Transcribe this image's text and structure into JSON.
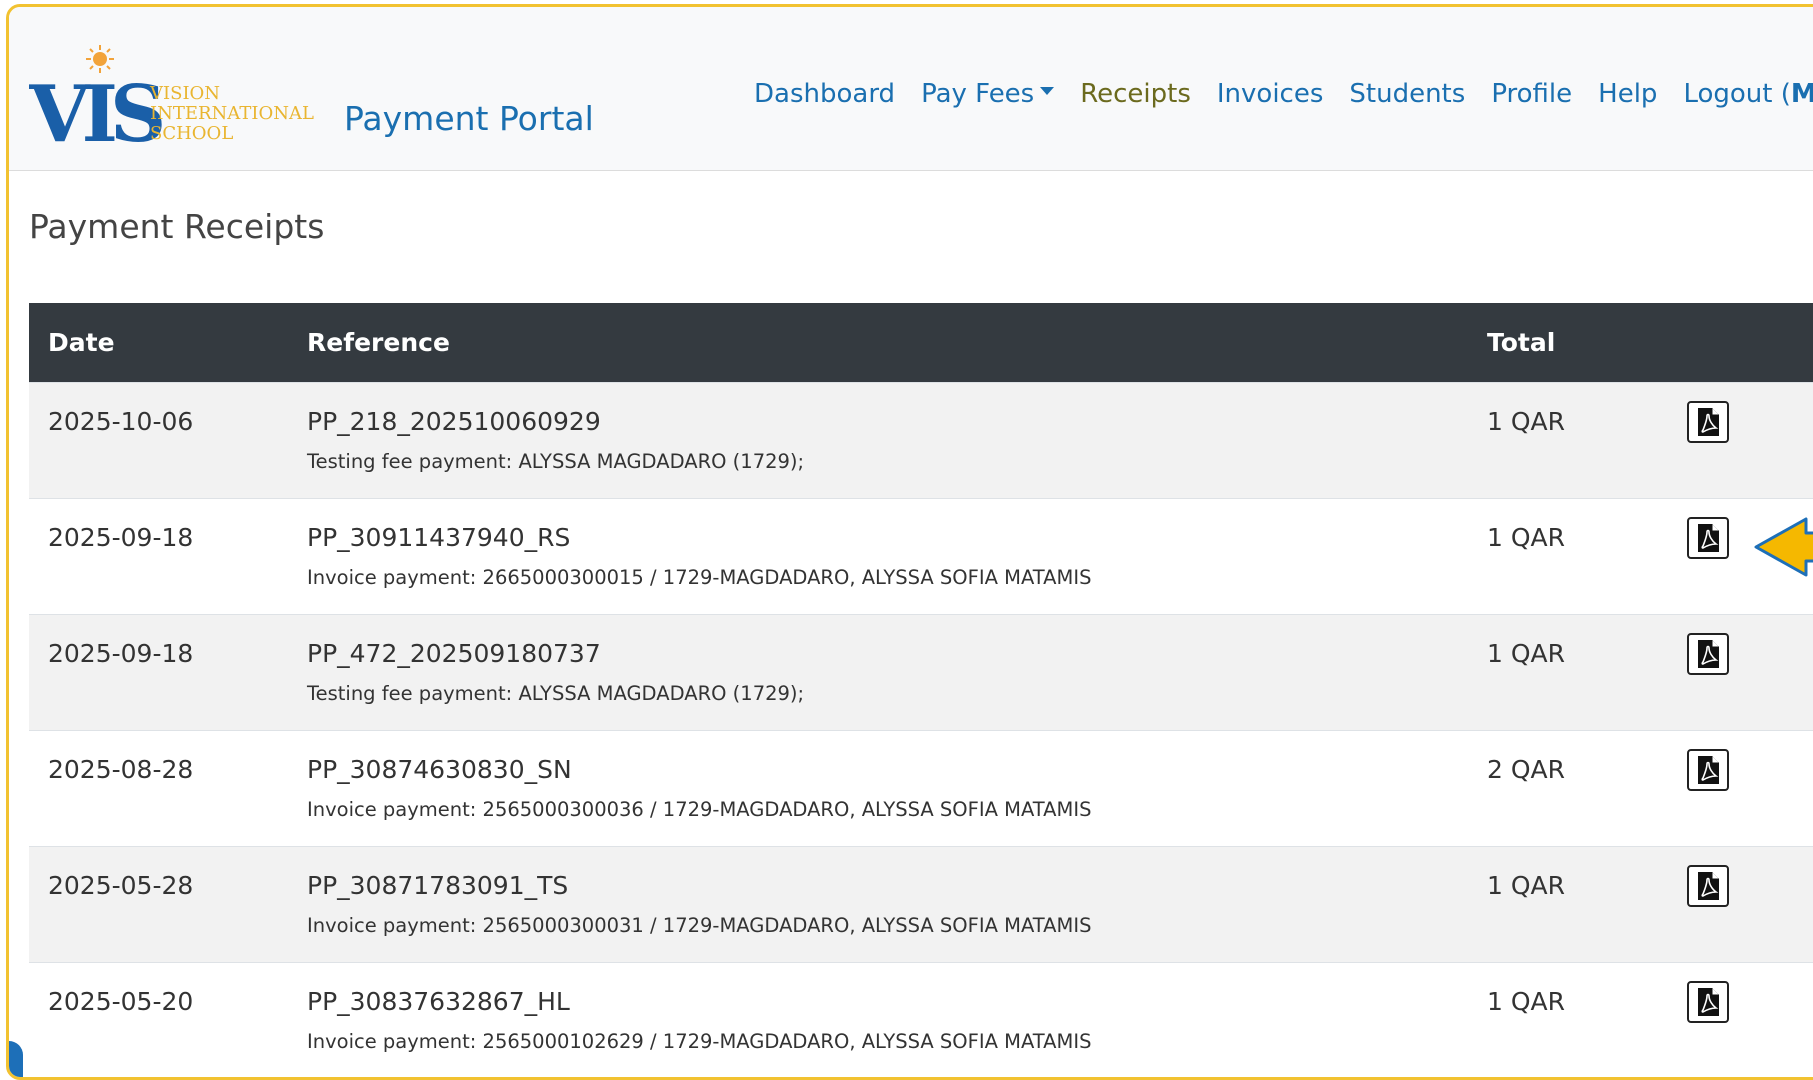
{
  "header": {
    "logo": {
      "monogram": "VIS",
      "line1": "VISION",
      "line2": "INTERNATIONAL",
      "line3": "SCHOOL"
    },
    "brand": "Payment Portal",
    "nav": {
      "dashboard": "Dashboard",
      "pay_fees": "Pay Fees",
      "receipts": "Receipts",
      "invoices": "Invoices",
      "students": "Students",
      "profile": "Profile",
      "help": "Help",
      "logout_prefix": "Logout (",
      "logout_user": "Maureen",
      "logout_suffix": ")"
    },
    "active_nav": "Receipts"
  },
  "page": {
    "title": "Payment Receipts"
  },
  "table": {
    "columns": {
      "date": "Date",
      "reference": "Reference",
      "total": "Total"
    },
    "rows": [
      {
        "date": "2025-10-06",
        "reference": "PP_218_202510060929",
        "description": "Testing fee payment: ALYSSA MAGDADARO (1729);",
        "total": "1 QAR"
      },
      {
        "date": "2025-09-18",
        "reference": "PP_30911437940_RS",
        "description": "Invoice payment: 2665000300015 / 1729-MAGDADARO, ALYSSA SOFIA MATAMIS",
        "total": "1 QAR"
      },
      {
        "date": "2025-09-18",
        "reference": "PP_472_202509180737",
        "description": "Testing fee payment: ALYSSA MAGDADARO (1729);",
        "total": "1 QAR"
      },
      {
        "date": "2025-08-28",
        "reference": "PP_30874630830_SN",
        "description": "Invoice payment: 2565000300036 / 1729-MAGDADARO, ALYSSA SOFIA MATAMIS",
        "total": "2 QAR"
      },
      {
        "date": "2025-05-28",
        "reference": "PP_30871783091_TS",
        "description": "Invoice payment: 2565000300031 / 1729-MAGDADARO, ALYSSA SOFIA MATAMIS",
        "total": "1 QAR"
      },
      {
        "date": "2025-05-20",
        "reference": "PP_30837632867_HL",
        "description": "Invoice payment: 2565000102629 / 1729-MAGDADARO, ALYSSA SOFIA MATAMIS",
        "total": "1 QAR"
      }
    ]
  },
  "icons": {
    "download": "pdf-file-icon",
    "annotation": "arrow-pointer-icon"
  },
  "colors": {
    "link": "#1a6fb0",
    "active_link": "#6b6a1e",
    "table_header": "#343a40",
    "frame_border": "#f2c230",
    "arrow": "#f5b800"
  }
}
